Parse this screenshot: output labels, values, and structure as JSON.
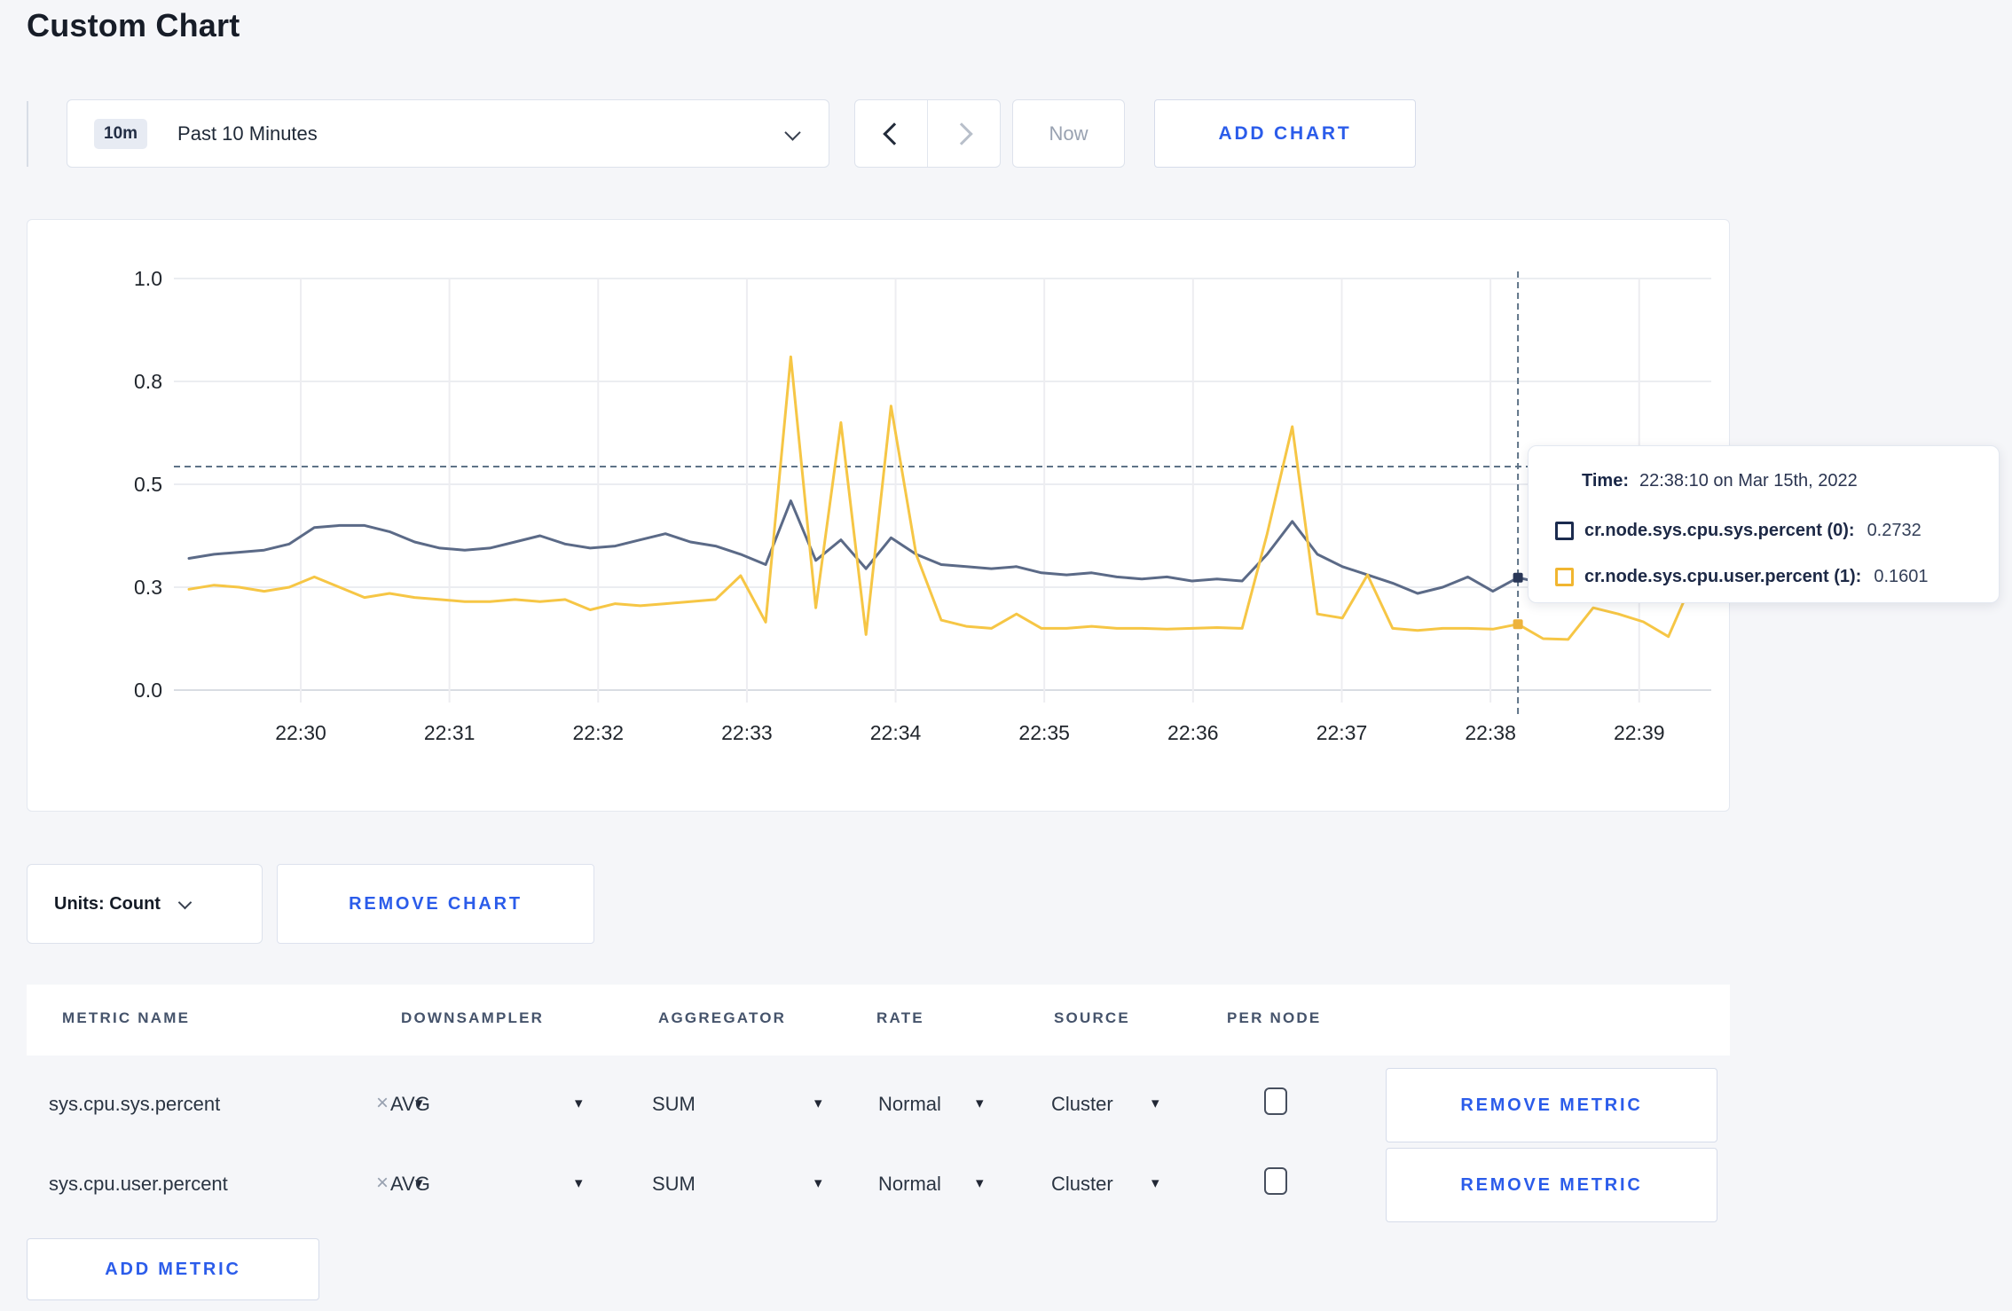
{
  "page": {
    "title": "Custom Chart",
    "background": "#f5f6f9",
    "accent_blue": "#2b5cea"
  },
  "icons": {
    "caret_down": "▾",
    "clear_x": "×"
  },
  "toolbar": {
    "time_range": {
      "badge": "10m",
      "label": "Past 10 Minutes"
    },
    "now_label": "Now",
    "add_chart_label": "ADD CHART"
  },
  "chart": {
    "tooltip": {
      "time_label": "Time:",
      "time_value": "22:38:10 on Mar 15th, 2022",
      "rows": [
        {
          "name": "cr.node.sys.cpu.sys.percent (0):",
          "value": "0.2732",
          "swatch": "#1b2b4e"
        },
        {
          "name": "cr.node.sys.cpu.user.percent (1):",
          "value": "0.1601",
          "swatch": "#f1b630"
        }
      ]
    }
  },
  "chart_data": {
    "type": "line",
    "title": "",
    "xlabel": "",
    "ylabel": "",
    "ylim": [
      0,
      1
    ],
    "grid": true,
    "x_start": "22:29:20",
    "x_interval_seconds": 10,
    "x_tick_labels": [
      "22:30",
      "22:31",
      "22:32",
      "22:33",
      "22:34",
      "22:35",
      "22:36",
      "22:37",
      "22:38",
      "22:39"
    ],
    "y_tick_values": [
      0,
      0.25,
      0.5,
      0.75,
      1.0
    ],
    "y_tick_labels": [
      "0.0",
      "0.3",
      "0.5",
      "0.8",
      "1.0"
    ],
    "series": [
      {
        "name": "cr.node.sys.cpu.sys.percent",
        "color": "#5b6a87",
        "marker": "#2a3858",
        "values": [
          0.32,
          0.33,
          0.335,
          0.34,
          0.355,
          0.395,
          0.4,
          0.4,
          0.385,
          0.36,
          0.345,
          0.34,
          0.345,
          0.36,
          0.375,
          0.355,
          0.345,
          0.35,
          0.365,
          0.38,
          0.36,
          0.35,
          0.33,
          0.305,
          0.46,
          0.315,
          0.365,
          0.295,
          0.37,
          0.33,
          0.305,
          0.3,
          0.295,
          0.3,
          0.285,
          0.28,
          0.285,
          0.275,
          0.27,
          0.275,
          0.265,
          0.27,
          0.265,
          0.33,
          0.41,
          0.33,
          0.3,
          0.28,
          0.26,
          0.235,
          0.25,
          0.275,
          0.24,
          0.2732,
          0.26,
          0.255,
          0.26,
          0.27,
          0.28,
          0.27,
          0.28
        ]
      },
      {
        "name": "cr.node.sys.cpu.user.percent",
        "color": "#f6c645",
        "marker": "#edb33c",
        "values": [
          0.245,
          0.255,
          0.25,
          0.24,
          0.25,
          0.275,
          0.25,
          0.225,
          0.235,
          0.225,
          0.22,
          0.215,
          0.215,
          0.22,
          0.215,
          0.22,
          0.195,
          0.21,
          0.205,
          0.21,
          0.215,
          0.22,
          0.278,
          0.165,
          0.81,
          0.2,
          0.65,
          0.135,
          0.69,
          0.33,
          0.17,
          0.155,
          0.15,
          0.185,
          0.15,
          0.15,
          0.155,
          0.15,
          0.15,
          0.148,
          0.15,
          0.152,
          0.15,
          0.38,
          0.64,
          0.185,
          0.175,
          0.28,
          0.15,
          0.145,
          0.15,
          0.15,
          0.148,
          0.1601,
          0.125,
          0.123,
          0.2,
          0.185,
          0.166,
          0.13,
          0.27
        ]
      }
    ],
    "crosshair": {
      "index": 53,
      "time": "22:38:10",
      "y_frac": 0.543
    },
    "legend_position": "tooltip"
  },
  "chart_controls": {
    "units_label": "Units: Count",
    "remove_chart_label": "REMOVE CHART",
    "add_metric_label": "ADD METRIC"
  },
  "metrics_table": {
    "headers": [
      "METRIC NAME",
      "DOWNSAMPLER",
      "AGGREGATOR",
      "RATE",
      "SOURCE",
      "PER NODE"
    ],
    "rows": [
      {
        "metric": "sys.cpu.sys.percent",
        "downsampler": "AVG",
        "aggregator": "SUM",
        "rate": "Normal",
        "source": "Cluster",
        "per_node": false,
        "remove_label": "REMOVE METRIC"
      },
      {
        "metric": "sys.cpu.user.percent",
        "downsampler": "AVG",
        "aggregator": "SUM",
        "rate": "Normal",
        "source": "Cluster",
        "per_node": false,
        "remove_label": "REMOVE METRIC"
      }
    ]
  }
}
